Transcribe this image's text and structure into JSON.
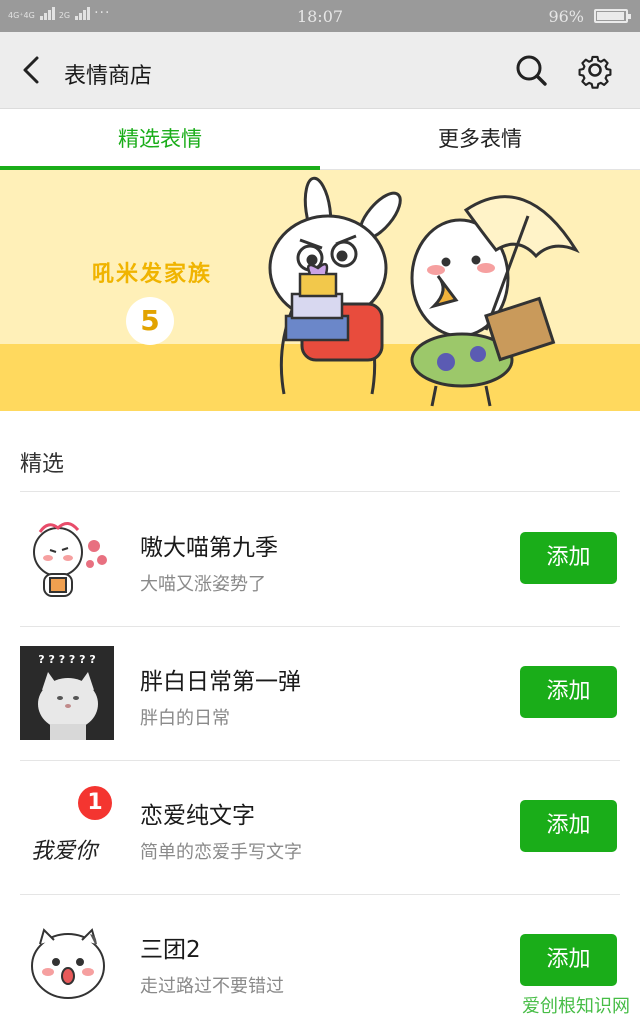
{
  "status_bar": {
    "network_label_1": "4G⁺4G",
    "network_label_2": "2G",
    "more": "···",
    "time": "18:07",
    "battery": "96%",
    "battery_level": 0.96
  },
  "header": {
    "back_icon": "back-chevron-icon",
    "title": "表情商店",
    "search_icon": "search-icon",
    "settings_icon": "gear-icon"
  },
  "tabs": [
    {
      "label": "精选表情",
      "active": true
    },
    {
      "label": "更多表情",
      "active": false
    }
  ],
  "banner": {
    "title": "吼米发家族",
    "number": "5"
  },
  "section": {
    "title": "精选"
  },
  "items": [
    {
      "title": "嗷大喵第九季",
      "subtitle": "大喵又涨姿势了",
      "button": "添加"
    },
    {
      "title": "胖白日常第一弹",
      "subtitle": "胖白的日常",
      "button": "添加",
      "thumb_text": "? ? ? ? ? ?"
    },
    {
      "title": "恋爱纯文字",
      "subtitle": "简单的恋爱手写文字",
      "button": "添加",
      "thumb_text": "我爱你",
      "badge": "1"
    },
    {
      "title": "三团2",
      "subtitle": "走过路过不要错过",
      "button": "添加"
    }
  ],
  "watermark": "爱创根知识网",
  "colors": {
    "accent": "#1aad19",
    "badge": "#f43530",
    "header_bg": "#ededed",
    "status_bg": "#9a9a9a"
  }
}
